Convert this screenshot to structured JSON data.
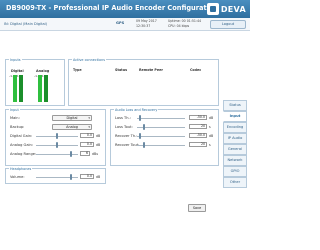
{
  "header": {
    "title": "DB9009-TX - Professional IP Audio Encoder Configuration",
    "brand": "DEVA",
    "brand_sub": "Broadcast Ltd."
  },
  "infobar": {
    "device_label": "IN: Digital (Main Digital)",
    "gps_label": "GPS",
    "date": "09 May 2017",
    "time": "12:30:37",
    "uptime_label": "Uptime:",
    "uptime_value": "00 01:51:44",
    "cpu_label": "CPU:",
    "cpu_value": "04 kbps",
    "logout_label": "Logout"
  },
  "inputs": {
    "title": "Inputs",
    "digital_label": "Digital",
    "analog_label": "Analog",
    "digital_values": "-1.8   -1.8",
    "analog_values": "-1.8   -1.8"
  },
  "connections": {
    "title": "Active connections",
    "columns": [
      "Type",
      "Status",
      "Remote Peer",
      "Codec"
    ]
  },
  "input_section": {
    "title": "Input",
    "main_label": "Main:",
    "main_value": "Digital",
    "backup_label": "Backup:",
    "backup_value": "Analog",
    "digital_gain_label": "Digital Gain:",
    "digital_gain_value": "0.0",
    "analog_gain_label": "Analog Gain:",
    "analog_gain_value": "0.0",
    "analog_range_label": "Analog Range:",
    "analog_range_value": "6",
    "db_unit": "dB",
    "dbu_unit": "dBu"
  },
  "loss_recovery": {
    "title": "Audio Loss and Recovery",
    "loss_th_label": "Loss Th.:",
    "loss_th_value": "-50.0",
    "loss_tout_label": "Loss Tout:",
    "loss_tout_value": "20",
    "recover_th_label": "Recover Th.:",
    "recover_th_value": "-50.0",
    "recover_tout_label": "Recover Tout:",
    "recover_tout_value": "20",
    "db_unit": "dB",
    "s_unit": "s"
  },
  "headphones": {
    "title": "Headphones",
    "volume_label": "Volume:",
    "volume_value": "0.0",
    "db_unit": "dB"
  },
  "save_label": "Save",
  "nav": {
    "items": [
      "Status",
      "Input",
      "Encoding",
      "IP Audio",
      "General",
      "Network",
      "GPIO",
      "Other"
    ]
  }
}
